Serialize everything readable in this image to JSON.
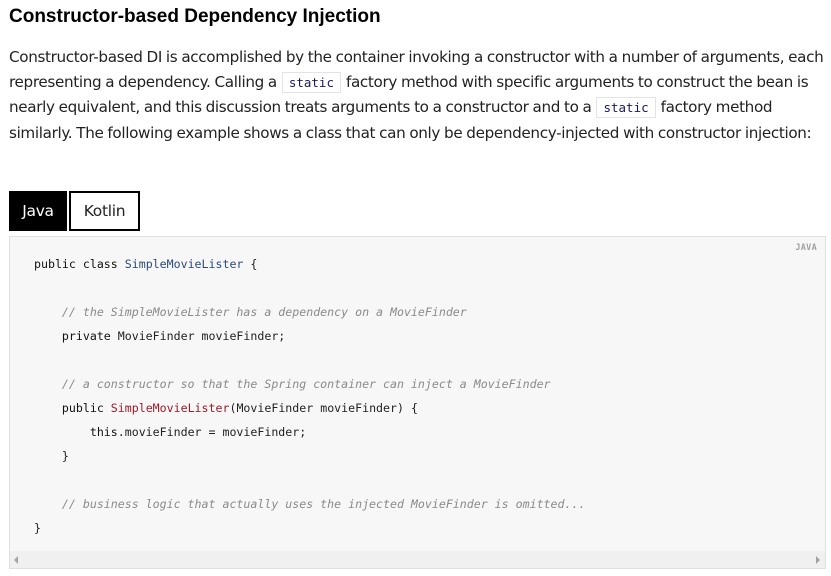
{
  "heading": "Constructor-based Dependency Injection",
  "paragraph": {
    "part1": "Constructor-based DI is accomplished by the container invoking a constructor with a number of arguments, each representing a dependency. Calling a ",
    "code1": "static",
    "part2": " factory method with specific arguments to construct the bean is nearly equivalent, and this discussion treats arguments to a constructor and to a ",
    "code2": "static",
    "part3": " factory method similarly. The following example shows a class that can only be dependency-injected with constructor injection:"
  },
  "tabs": [
    {
      "label": "Java",
      "active": true
    },
    {
      "label": "Kotlin",
      "active": false
    }
  ],
  "code_block": {
    "language_label": "JAVA",
    "lines": {
      "l1_kw": "public class ",
      "l1_cls": "SimpleMovieLister",
      "l1_end": " {",
      "l3_comment": "// the SimpleMovieLister has a dependency on a MovieFinder",
      "l4_kw": "private ",
      "l4_rest": "MovieFinder movieFinder;",
      "l6_comment": "// a constructor so that the Spring container can inject a MovieFinder",
      "l7_kw": "public ",
      "l7_fn": "SimpleMovieLister",
      "l7_rest": "(MovieFinder movieFinder) {",
      "l8_kw": "this",
      "l8_rest": ".movieFinder = movieFinder;",
      "l9": "}",
      "l11_comment": "// business logic that actually uses the injected MovieFinder is omitted...",
      "l12": "}"
    }
  },
  "scrollbar": {
    "left_icon": "arrow-left-icon",
    "right_icon": "arrow-right-icon"
  }
}
